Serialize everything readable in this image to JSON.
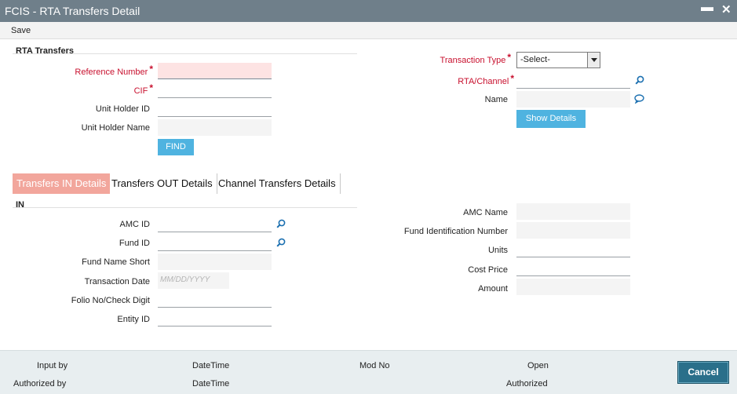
{
  "window": {
    "title": "FCIS - RTA Transfers Detail",
    "minimize": "▬",
    "close": "✕"
  },
  "menu": {
    "save": "Save"
  },
  "rta": {
    "section_title": "RTA Transfers",
    "reference_number_label": "Reference Number",
    "cif_label": "CIF",
    "unit_holder_id_label": "Unit Holder ID",
    "unit_holder_name_label": "Unit Holder Name",
    "find_button": "FIND",
    "transaction_type_label": "Transaction Type",
    "transaction_type_value": "-Select-",
    "rta_channel_label": "RTA/Channel",
    "name_label": "Name",
    "show_details_button": "Show Details",
    "required_mark": "*"
  },
  "tabs": [
    {
      "label": "Transfers IN Details",
      "active": true
    },
    {
      "label": "Transfers OUT Details",
      "active": false
    },
    {
      "label": "Channel Transfers Details",
      "active": false
    }
  ],
  "in": {
    "section_title": "IN",
    "amc_id_label": "AMC ID",
    "fund_id_label": "Fund ID",
    "fund_name_short_label": "Fund Name Short",
    "transaction_date_label": "Transaction Date",
    "transaction_date_placeholder": "MM/DD/YYYY",
    "folio_label": "Folio No/Check Digit",
    "entity_id_label": "Entity ID",
    "amc_name_label": "AMC Name",
    "fund_identification_number_label": "Fund Identification Number",
    "units_label": "Units",
    "cost_price_label": "Cost Price",
    "amount_label": "Amount"
  },
  "footer": {
    "input_by": "Input by",
    "authorized_by": "Authorized by",
    "datetime_1": "DateTime",
    "datetime_2": "DateTime",
    "mod_no": "Mod No",
    "open": "Open",
    "authorized": "Authorized",
    "cancel_button": "Cancel"
  },
  "icons": {
    "search": "search-icon",
    "chat": "chat-icon"
  },
  "colors": {
    "titlebar": "#6f7f8a",
    "required": "#c8102e",
    "button_blue": "#4fb3e0",
    "active_tab": "#f2a69c",
    "footer": "#e8eef0",
    "cancel": "#2a6f8a"
  }
}
